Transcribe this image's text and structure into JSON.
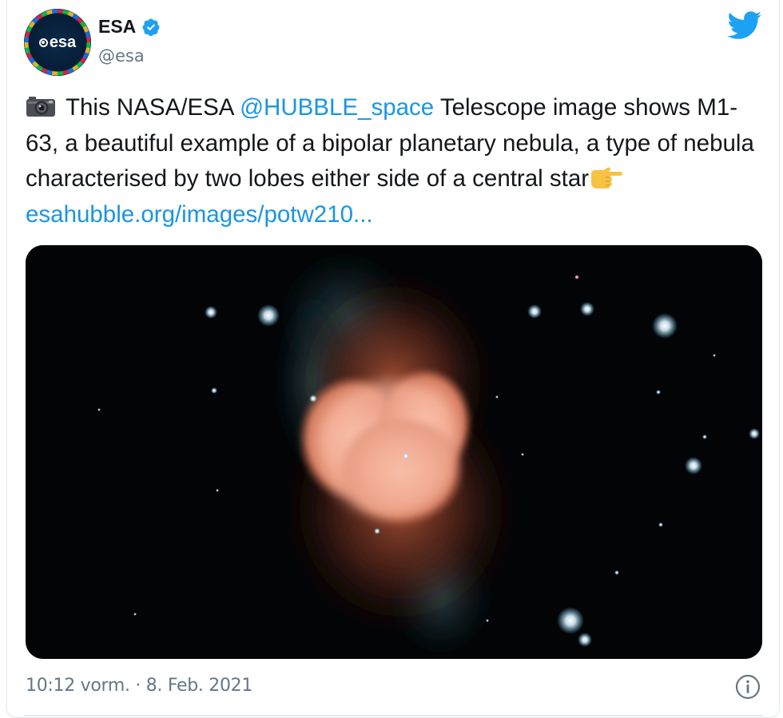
{
  "author": {
    "name": "ESA",
    "handle": "@esa",
    "avatar_text": "esa",
    "verified_icon": "verified-badge-icon",
    "verified_color": "#1da1f2"
  },
  "brand": {
    "logo_icon": "twitter-bird-icon",
    "color": "#1da1f2"
  },
  "tweet": {
    "camera_icon": "camera-emoji",
    "text_1": "This NASA/ESA ",
    "mention": "@HUBBLE_space",
    "text_2": " Telescope image shows M1-63, a beautiful example of a bipolar planetary nebula, a type of nebula characterised by two lobes either side of a central star",
    "pointing_icon": "pointing-right-emoji",
    "link": "esahubble.org/images/potw210...",
    "link_color": "#1b95e0"
  },
  "media": {
    "icon": "nebula-photo"
  },
  "footer": {
    "timestamp": "10:12 vorm. · 8. Feb. 2021",
    "info_icon": "info-icon"
  }
}
